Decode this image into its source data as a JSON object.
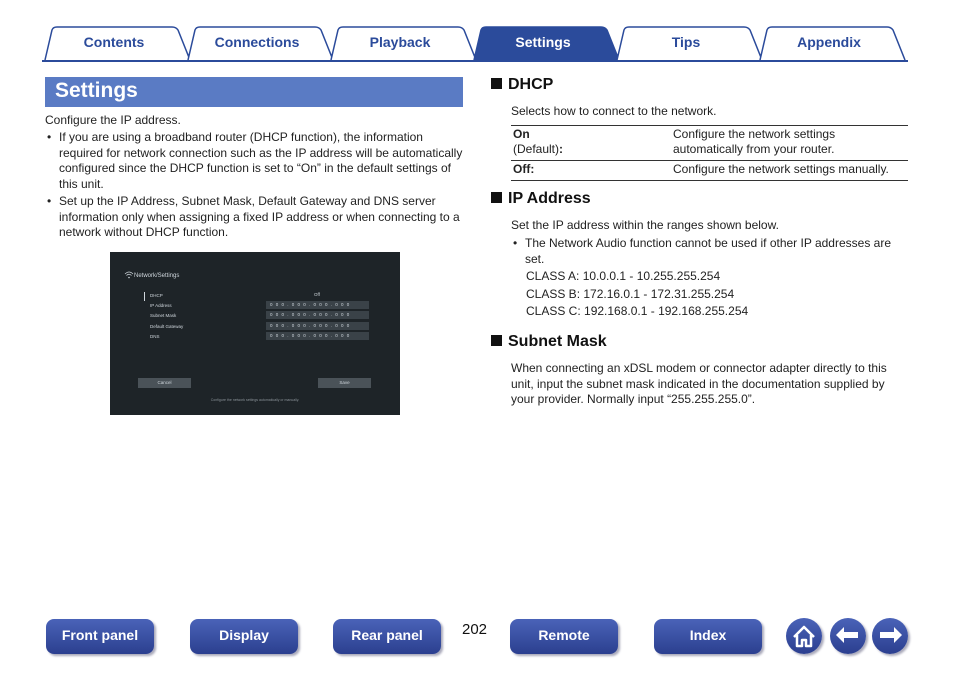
{
  "tabs": [
    {
      "label": "Contents",
      "active": false
    },
    {
      "label": "Connections",
      "active": false
    },
    {
      "label": "Playback",
      "active": false
    },
    {
      "label": "Settings",
      "active": true
    },
    {
      "label": "Tips",
      "active": false
    },
    {
      "label": "Appendix",
      "active": false
    }
  ],
  "left": {
    "title": "Settings",
    "intro": "Configure the IP address.",
    "bullets": [
      "If you are using a broadband router (DHCP function), the information required for network connection such as the IP address will be automatically configured since the DHCP function is set to “On” in the default settings of this unit.",
      "Set up the IP Address, Subnet Mask, Default Gateway and DNS server information only when assigning a fixed IP address or when connecting to a network without DHCP function."
    ]
  },
  "screen": {
    "header": "Network/Settings",
    "dhcp_label": "DHCP",
    "dhcp_value": "Off",
    "rows": [
      {
        "label": "IP Address",
        "value": "0 0 0 . 0 0 0 . 0 0 0 . 0 0 0"
      },
      {
        "label": "Subnet Mask",
        "value": "0 0 0 . 0 0 0 . 0 0 0 . 0 0 0"
      },
      {
        "label": "Default Gateway",
        "value": "0 0 0 . 0 0 0 . 0 0 0 . 0 0 0"
      },
      {
        "label": "DNS",
        "value": "0 0 0 . 0 0 0 . 0 0 0 . 0 0 0"
      }
    ],
    "cancel": "Cancel",
    "save": "Save",
    "footer": "Configure the network settings automatically or manually."
  },
  "dhcp": {
    "heading": "DHCP",
    "desc": "Selects how to connect to the network.",
    "on_key": "On",
    "on_default": "(Default)",
    "on_colon": ":",
    "on_value": "Configure the network settings automatically from your router.",
    "off_key": "Off:",
    "off_value": "Configure the network settings manually."
  },
  "ip": {
    "heading": "IP Address",
    "desc": "Set the IP address within the ranges shown below.",
    "bullet": "The Network Audio function cannot be used if other IP addresses are set.",
    "class_a": "CLASS A: 10.0.0.1 - 10.255.255.254",
    "class_b": "CLASS B: 172.16.0.1 - 172.31.255.254",
    "class_c": "CLASS C: 192.168.0.1 - 192.168.255.254"
  },
  "subnet": {
    "heading": "Subnet Mask",
    "desc": "When connecting an xDSL modem or connector adapter directly to this unit, input the subnet mask indicated in the documentation supplied by your provider. Normally input “255.255.255.0”."
  },
  "bottom_nav": {
    "front_panel": "Front panel",
    "display": "Display",
    "rear_panel": "Rear panel",
    "page_number": "202",
    "remote": "Remote",
    "index": "Index",
    "home_icon": "home-icon",
    "back_icon": "arrow-left-icon",
    "forward_icon": "arrow-right-icon"
  },
  "colors": {
    "accent": "#2b4b9b",
    "title_bar": "#5a7bc4",
    "screen_bg": "#1e2428"
  }
}
